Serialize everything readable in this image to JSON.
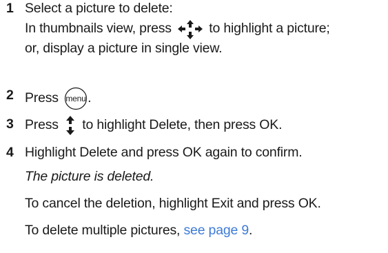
{
  "steps": [
    {
      "number": "1",
      "lines": [
        "Select a picture to delete:",
        "In thumbnails view, press",
        "to highlight a picture;",
        "or, display a picture in single view."
      ]
    },
    {
      "number": "2",
      "press_label": "Press",
      "button_label": "menu",
      "suffix": "."
    },
    {
      "number": "3",
      "press_label": "Press",
      "text_after": "to highlight Delete, then press OK."
    },
    {
      "number": "4",
      "line1": "Highlight Delete and press OK again to confirm.",
      "result": "The picture is deleted.",
      "cancel_text": "To cancel the deletion, highlight Exit and press OK.",
      "multi_text": "To delete multiple pictures,",
      "link_text": "see page 9",
      "multi_suffix": "."
    }
  ],
  "colors": {
    "text": "#1a1a1a",
    "link": "#3d7bd8"
  },
  "icons": {
    "four_way": "four-way-arrow-icon",
    "up_down": "up-down-arrow-icon",
    "menu_button": "menu-button-icon"
  }
}
